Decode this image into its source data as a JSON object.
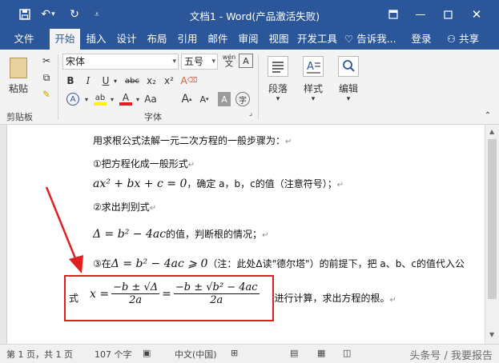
{
  "window": {
    "title": "文档1 - Word(产品激活失败)"
  },
  "tabs": [
    "文件",
    "开始",
    "插入",
    "设计",
    "布局",
    "引用",
    "邮件",
    "审阅",
    "视图",
    "开发工具"
  ],
  "active_tab": "开始",
  "tellme": "告诉我...",
  "login": "登录",
  "share": "共享",
  "ribbon": {
    "paste_label": "粘贴",
    "clipboard_group": "剪贴板",
    "font_name": "宋体",
    "font_size": "五号",
    "wen_label": "wén",
    "font_group": "字体",
    "paragraph_label": "段落",
    "styles_label": "样式",
    "editing_label": "编辑",
    "bold": "B",
    "italic": "I",
    "underline": "U",
    "strike": "abc",
    "sub": "x₂",
    "sup": "x²",
    "clear": "A",
    "textfx": "A",
    "highlight": "ab",
    "fontcolor": "A",
    "grow": "A",
    "shrink": "A",
    "shade": "A",
    "circled": "字"
  },
  "doc": {
    "line1": "用求根公式法解一元二次方程的一般步骤为：",
    "line2": "①把方程化成一般形式",
    "line3_eq": "ax² + bx + c = 0",
    "line3_text": "，确定 a，b，c的值（注意符号）；",
    "line4": "②求出判别式",
    "line5_eq": "Δ = b² − 4ac",
    "line5_text": "的值，判断根的情况；",
    "line6_pre": "③在",
    "line6_eq": "Δ = b² − 4ac ⩾ 0",
    "line6_text": "（注：此处Δ读\"德尔塔\"）的前提下，把 a、b、c的值代入公",
    "line7_pre": "式",
    "formula_lhs": "x =",
    "frac1_num": "−b ± √Δ",
    "frac1_den": "2a",
    "equals": "=",
    "frac2_num": "−b ± √b² − 4ac",
    "frac2_den": "2a",
    "line7_text": "进行计算，求出方程的根。",
    "para_mark": "↵"
  },
  "status": {
    "page": "第 1 页，共 1 页",
    "words": "107 个字",
    "lang": "中文(中国)"
  },
  "watermark": "头条号 / 我要报告",
  "colors": {
    "accent": "#2b579a",
    "highlight": "#fff200",
    "fontcolor": "#e02020",
    "box": "#e02020"
  }
}
